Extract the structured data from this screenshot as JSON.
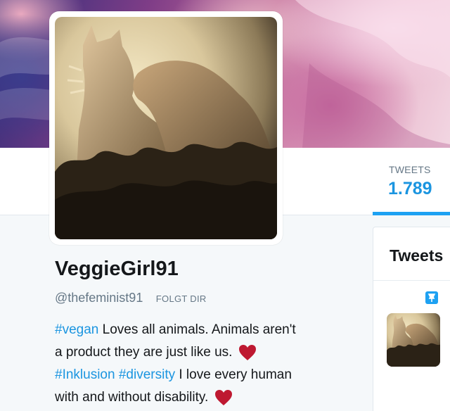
{
  "profile": {
    "name": "VeggieGirl91",
    "handle": "@thefeminist91",
    "follows_you_badge": "FOLGT DIR",
    "bio_lines": [
      {
        "tag": "#vegan",
        "text": " Loves all animals. Animals aren't"
      },
      {
        "text": "a product they are just like us."
      },
      {
        "tag1": "#Inklusion",
        "tag2": "#diversity",
        "text": " I love every human"
      },
      {
        "text": "with and without disability."
      }
    ]
  },
  "nav": {
    "tweets_label": "TWEETS",
    "tweets_count": "1.789"
  },
  "timeline": {
    "title": "Tweets"
  },
  "colors": {
    "link_blue": "#1b95e0",
    "accent_blue": "#1da1f2",
    "heart_red": "#be1931",
    "muted_gray": "#657786",
    "text_dark": "#14171a"
  },
  "icons": {
    "heart": "heart-icon",
    "pin": "pinned-tweet-icon"
  }
}
